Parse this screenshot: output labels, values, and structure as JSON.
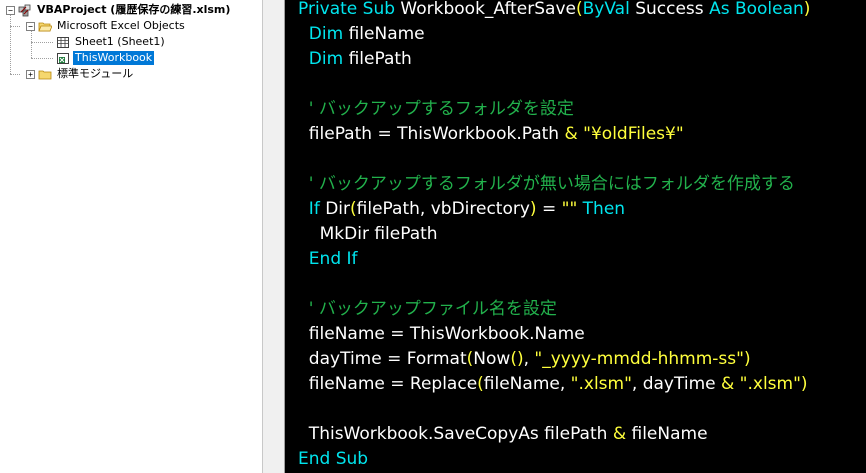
{
  "explorer": {
    "project_label": "VBAProject (履歴保存の練習.xlsm)",
    "excel_objects_label": "Microsoft Excel Objects",
    "sheet1_label": "Sheet1 (Sheet1)",
    "thisworkbook_label": "ThisWorkbook",
    "modules_label": "標準モジュール",
    "expanded_glyph": "−",
    "collapsed_glyph": "+"
  },
  "code": {
    "l1": {
      "a": "Private Sub",
      "b": " Workbook_AfterSave",
      "c": "(",
      "d": "ByVal",
      "e": " Success ",
      "f": "As Boolean",
      "g": ")"
    },
    "l2": {
      "a": "  Dim",
      "b": " fileName"
    },
    "l3": {
      "a": "  Dim",
      "b": " filePath"
    },
    "l5": {
      "a": "  ' バックアップするフォルダを設定"
    },
    "l6": {
      "a": "  filePath = ThisWorkbook.Path ",
      "b": "&",
      "c": " ",
      "d": "\"¥oldFiles¥\""
    },
    "l8": {
      "a": "  ' バックアップするフォルダが無い場合にはフォルダを作成する"
    },
    "l9": {
      "a": "  If",
      "b": " Dir",
      "c": "(",
      "d": "filePath, vbDirectory",
      "e": ")",
      "f": " = ",
      "g": "\"\"",
      "h": " Then"
    },
    "l10": {
      "a": "    MkDir filePath"
    },
    "l11": {
      "a": "  End If"
    },
    "l13": {
      "a": "  ' バックアップファイル名を設定"
    },
    "l14": {
      "a": "  fileName = ThisWorkbook.Name"
    },
    "l15": {
      "a": "  dayTime = Format",
      "b": "(",
      "c": "Now",
      "d": "()",
      "e": ", ",
      "f": "\"_yyyy-mmdd-hhmm-ss\"",
      "g": ")"
    },
    "l16": {
      "a": "  fileName = Replace",
      "b": "(",
      "c": "fileName, ",
      "d": "\".xlsm\"",
      "e": ", dayTime ",
      "f": "&",
      "g": " ",
      "h": "\".xlsm\"",
      "i": ")"
    },
    "l18": {
      "a": "  ThisWorkbook.SaveCopyAs filePath ",
      "b": "&",
      "c": " fileName"
    },
    "l19": {
      "a": "End Sub"
    }
  },
  "colors": {
    "keyword": "#00e5ee",
    "string": "#ffff3c",
    "comment": "#22b14c",
    "selection": "#0078d7",
    "code_bg": "#000000"
  }
}
